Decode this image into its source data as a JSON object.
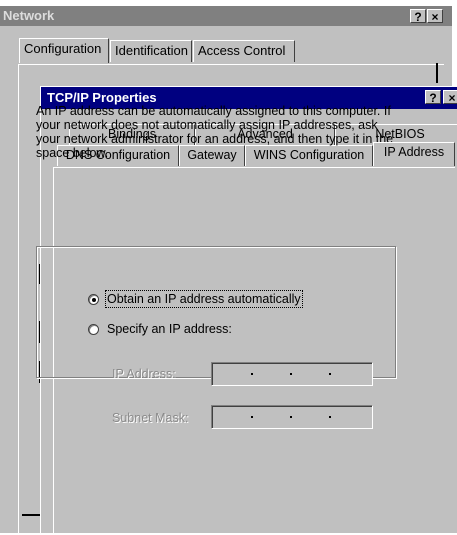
{
  "network": {
    "title": "Network",
    "help_glyph": "?",
    "close_glyph": "×",
    "tabs": [
      {
        "label": "Configuration"
      },
      {
        "label": "Identification"
      },
      {
        "label": "Access Control"
      }
    ]
  },
  "tcpip": {
    "title": "TCP/IP Properties",
    "help_glyph": "?",
    "close_glyph": "×",
    "tabs_back": [
      {
        "label": "Bindings"
      },
      {
        "label": "Advanced"
      },
      {
        "label": "NetBIOS"
      }
    ],
    "tabs_front": [
      {
        "label": "DNS Configuration"
      },
      {
        "label": "Gateway"
      },
      {
        "label": "WINS Configuration"
      },
      {
        "label": "IP Address"
      }
    ],
    "selected_tab": "IP Address",
    "description": "An IP address can be automatically assigned to this computer. If your network does not automatically assign IP addresses, ask your network administrator for an address, and then type it in the space below.",
    "options": {
      "auto_label": "Obtain an IP address automatically",
      "auto_selected": true,
      "specify_label": "Specify an IP address:",
      "specify_selected": false
    },
    "fields": {
      "ip_label": "IP Address:",
      "ip_value": "",
      "mask_label": "Subnet Mask:",
      "mask_value": ""
    }
  }
}
